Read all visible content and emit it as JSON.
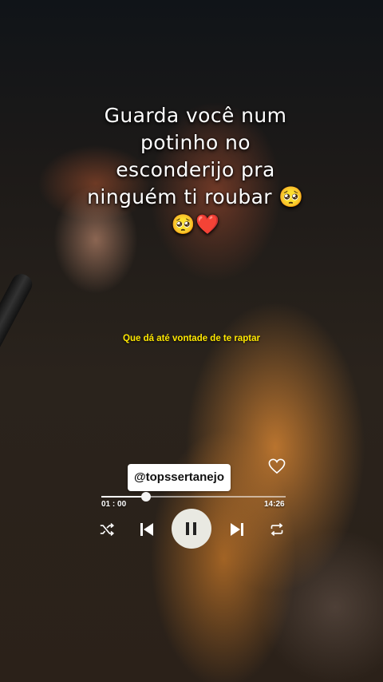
{
  "lyrics": {
    "main_line1": "Guarda você num",
    "main_line2": "potinho no",
    "main_line3": "esconderijo pra",
    "main_line4": "ninguém ti roubar 🥺",
    "main_line5": "🥺❤️",
    "subtitle": "Que dá até vontade de te raptar"
  },
  "player": {
    "handle": "@topssertanejo",
    "elapsed": "01 : 00",
    "total": "14:26",
    "progress": 0.243
  },
  "icons": {
    "like": "heart-outline-icon",
    "shuffle": "shuffle-icon",
    "previous": "skip-previous-icon",
    "pause": "pause-icon",
    "next": "skip-next-icon",
    "repeat": "repeat-icon"
  },
  "colors": {
    "subtitle": "#ffe800",
    "lyric_text": "#ffffff",
    "play_button": "#e9e9e2"
  }
}
